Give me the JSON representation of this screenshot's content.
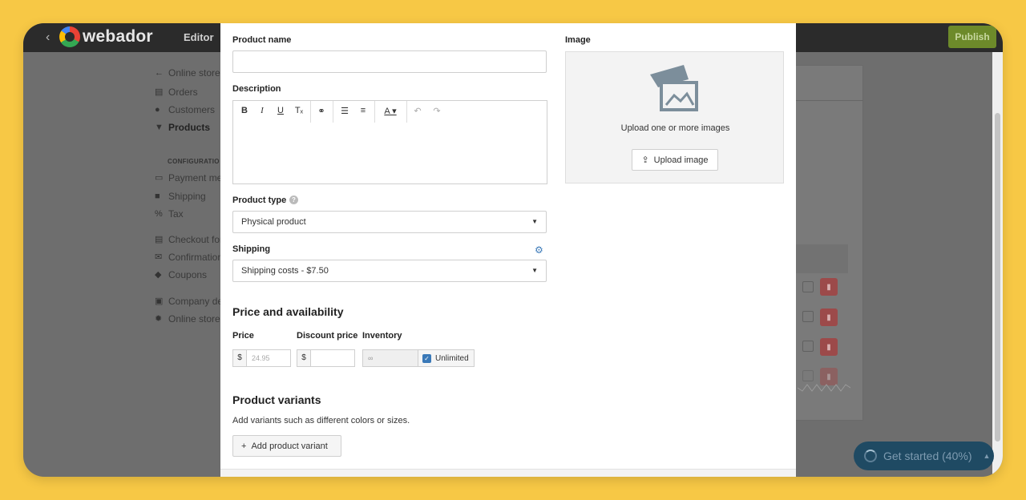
{
  "app": {
    "brand": "webador",
    "editor_label": "Editor",
    "publish_label": "Publish"
  },
  "sidebar": {
    "items": [
      {
        "label": "Online store",
        "icon": "arrow-left-icon"
      },
      {
        "label": "Orders",
        "icon": "document-icon"
      },
      {
        "label": "Customers",
        "icon": "person-icon"
      },
      {
        "label": "Products",
        "icon": "cart-icon",
        "active": true
      }
    ],
    "config_heading": "CONFIGURATIO",
    "config_items": [
      {
        "label": "Payment met",
        "icon": "card-icon"
      },
      {
        "label": "Shipping",
        "icon": "truck-icon"
      },
      {
        "label": "Tax",
        "icon": "percent-icon"
      },
      {
        "label": "Checkout for",
        "icon": "document-icon"
      },
      {
        "label": "Confirmation",
        "icon": "mail-icon"
      },
      {
        "label": "Coupons",
        "icon": "tag-icon"
      },
      {
        "label": "Company de",
        "icon": "id-card-icon"
      },
      {
        "label": "Online store",
        "icon": "gear-icon"
      }
    ]
  },
  "modal": {
    "product_name": {
      "label": "Product name",
      "value": ""
    },
    "description": {
      "label": "Description",
      "value": ""
    },
    "product_type": {
      "label": "Product type",
      "value": "Physical product"
    },
    "shipping": {
      "label": "Shipping",
      "value": "Shipping costs - $7.50"
    },
    "price_section": {
      "title": "Price and availability",
      "price_label": "Price",
      "price_currency": "$",
      "price_placeholder": "24.95",
      "discount_label": "Discount price",
      "discount_currency": "$",
      "inventory_label": "Inventory",
      "inventory_placeholder": "∞",
      "unlimited_label": "Unlimited",
      "unlimited_checked": true
    },
    "variants": {
      "title": "Product variants",
      "description": "Add variants such as different colors or sizes.",
      "button_label": "Add product variant"
    },
    "image": {
      "label": "Image",
      "hint": "Upload one or more images",
      "button_label": "Upload image"
    }
  },
  "get_started": {
    "label": "Get started (40%)",
    "progress": 0.4
  },
  "colors": {
    "background": "#f7c845",
    "accent": "#3a79b8",
    "publish": "#6d8a2a",
    "delete": "#9c4a4a"
  }
}
